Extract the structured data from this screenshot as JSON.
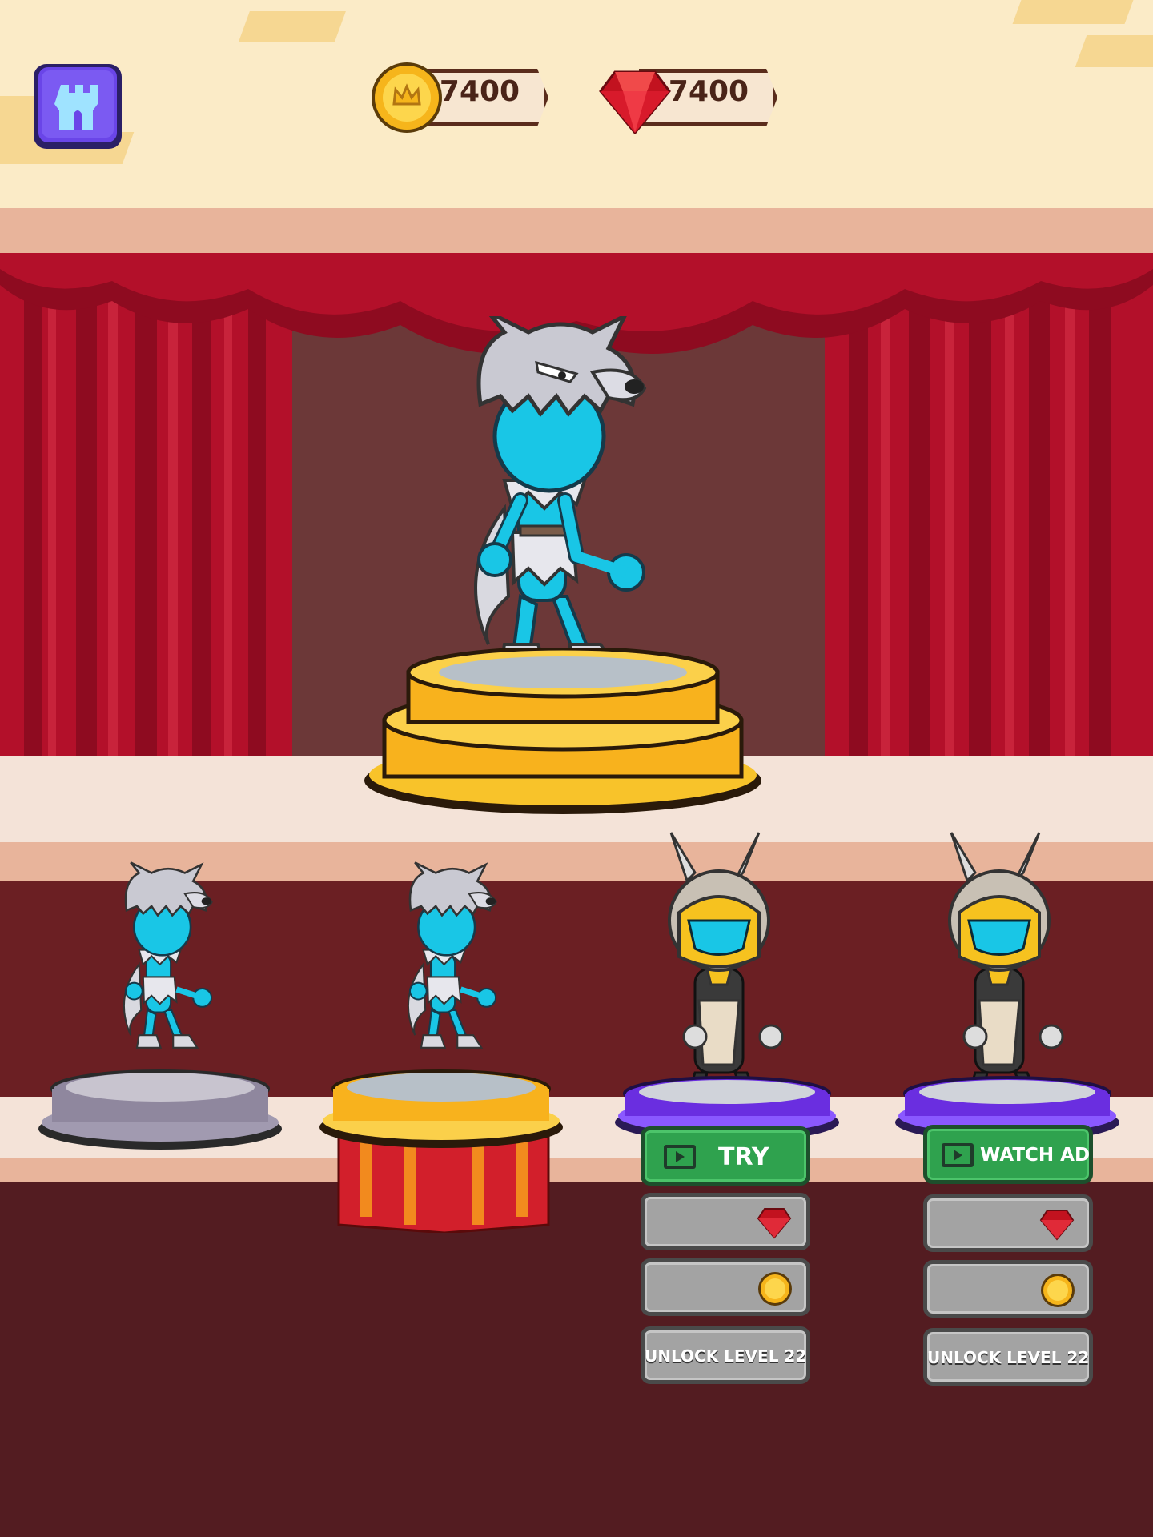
{
  "hud": {
    "coins": "7400",
    "gems": "7400",
    "menu_icon": "castle-tower-icon"
  },
  "stage": {
    "featured_character": "werewolf",
    "pedestal": "gold"
  },
  "shelf": {
    "slots": [
      {
        "character": "werewolf",
        "pedestal": "silver",
        "state": "owned"
      },
      {
        "character": "werewolf",
        "pedestal": "gold",
        "state": "selected"
      },
      {
        "character": "anubis-warrior",
        "pedestal": "purple",
        "state": "locked"
      },
      {
        "character": "anubis-warrior",
        "pedestal": "purple",
        "state": "locked"
      }
    ],
    "slot3_buttons": {
      "try_label": "TRY",
      "gem_icon": "red-gem-icon",
      "coin_icon": "gold-coin-icon",
      "unlock_label": "UNLOCK LEVEL 22"
    },
    "slot4_buttons": {
      "watch_label": "WATCH AD",
      "gem_icon": "red-gem-icon",
      "coin_icon": "gold-coin-icon",
      "unlock_label": "UNLOCK LEVEL 22"
    }
  },
  "colors": {
    "curtain": "#b3102a",
    "gold": "#f8b21d",
    "green_button": "#2fa24e",
    "gray_button": "#a3a3a3",
    "purple_pedestal": "#6a2ee0"
  }
}
